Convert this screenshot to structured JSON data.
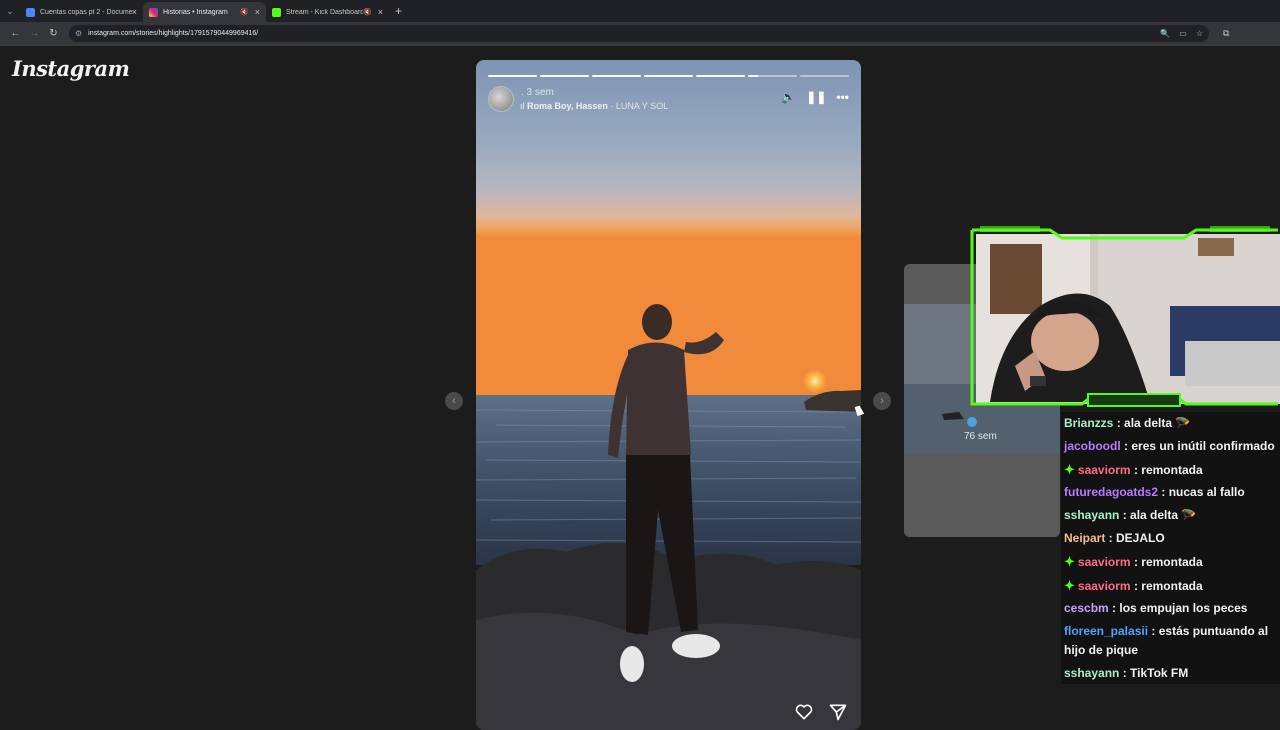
{
  "browser": {
    "tabs": [
      {
        "title": "Cuentas copas pt 2 - Documen",
        "favicon_color": "#4a86f5",
        "active": false,
        "muted": false
      },
      {
        "title": "Historias • Instagram",
        "favicon_color": "#e1306c",
        "active": true,
        "muted": true
      },
      {
        "title": "Stream - Kick Dashboard",
        "favicon_color": "#53fc18",
        "active": false,
        "muted": true
      }
    ],
    "url": "instagram.com/stories/highlights/17915790449969416/",
    "new_tab": "+",
    "close": "×",
    "tab_menu": "⌄"
  },
  "instagram": {
    "logo": "Instagram",
    "story": {
      "time": ". 3 sem",
      "artist": "Roma Boy, Hassen",
      "song": "LUNA Y SOL",
      "segments": 7,
      "completed_segments": 5,
      "icons": [
        "volume-icon",
        "pause-icon",
        "more-icon"
      ]
    },
    "preview": {
      "time": "76 sem"
    },
    "nav": {
      "prev": "‹",
      "next": "›"
    }
  },
  "stream": {
    "accent": "#53fc18",
    "chat": [
      {
        "user": "Brianzzs",
        "color": "#a8f0c8",
        "text": "ala delta 🪂",
        "badge": false
      },
      {
        "user": "jacoboodl",
        "color": "#b57bff",
        "text": "eres un inútil confirmado",
        "badge": false
      },
      {
        "user": "saaviorm",
        "color": "#ff6b8b",
        "text": "remontada",
        "badge": true
      },
      {
        "user": "futuredagoatds2",
        "color": "#b57bff",
        "text": "nucas al fallo",
        "badge": false
      },
      {
        "user": "sshayann",
        "color": "#a8f0c8",
        "text": "ala delta 🪂",
        "badge": false
      },
      {
        "user": "Neipart",
        "color": "#f5c08a",
        "text": "DEJALO",
        "badge": false
      },
      {
        "user": "saaviorm",
        "color": "#ff6b8b",
        "text": "remontada",
        "badge": true
      },
      {
        "user": "saaviorm",
        "color": "#ff6b8b",
        "text": "remontada",
        "badge": true
      },
      {
        "user": "cescbm",
        "color": "#c9a3ff",
        "text": "los empujan los peces",
        "badge": false
      },
      {
        "user": "floreen_palasii",
        "color": "#4aa3ff",
        "text": "estás puntuando al hijo de pique",
        "badge": false
      },
      {
        "user": "sshayann",
        "color": "#a8f0c8",
        "text": "TikTok FM",
        "badge": false
      }
    ]
  }
}
